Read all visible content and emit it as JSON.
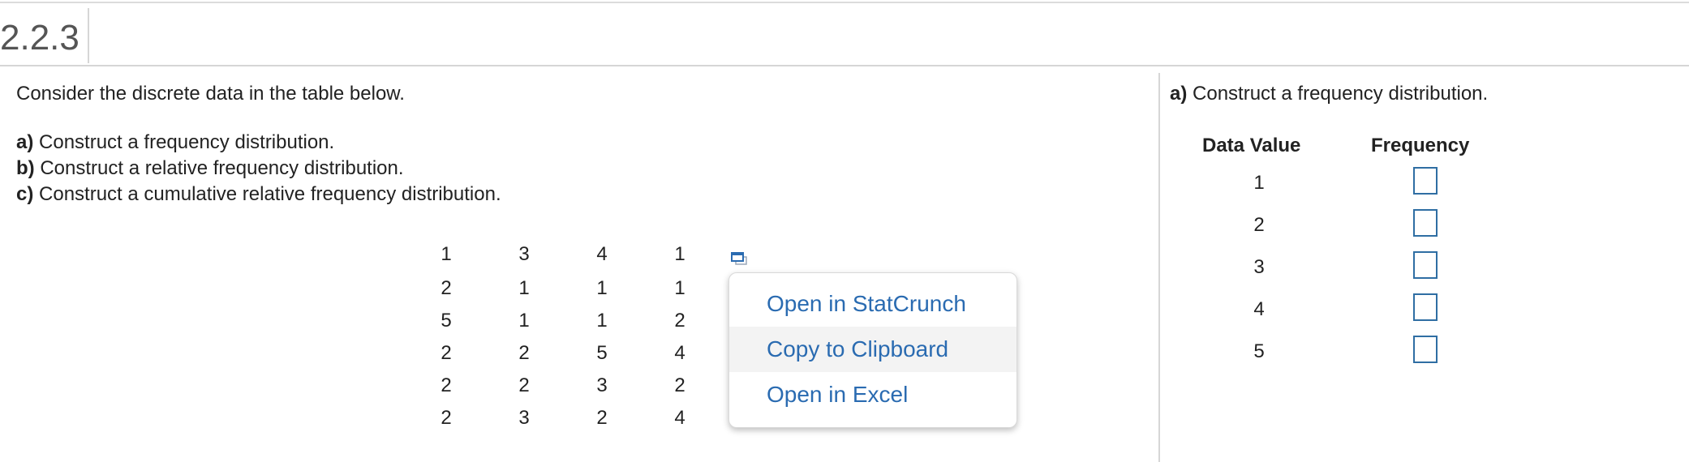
{
  "question_number": "2.2.3",
  "intro": "Consider the discrete data in the table below.",
  "tasks": [
    {
      "letter": "a)",
      "text": "Construct a frequency distribution."
    },
    {
      "letter": "b)",
      "text": "Construct a relative frequency distribution."
    },
    {
      "letter": "c)",
      "text": "Construct a cumulative relative frequency distribution."
    }
  ],
  "data_table": [
    [
      "1",
      "3",
      "4",
      "1"
    ],
    [
      "2",
      "1",
      "1",
      "1"
    ],
    [
      "5",
      "1",
      "1",
      "2"
    ],
    [
      "2",
      "2",
      "5",
      "4"
    ],
    [
      "2",
      "2",
      "3",
      "2"
    ],
    [
      "2",
      "3",
      "2",
      "4"
    ]
  ],
  "context_menu": [
    {
      "label": "Open in StatCrunch",
      "highlighted": false
    },
    {
      "label": "Copy to Clipboard",
      "highlighted": true
    },
    {
      "label": "Open in Excel",
      "highlighted": false
    }
  ],
  "answer": {
    "letter": "a)",
    "title": "Construct a frequency distribution.",
    "headers": {
      "data_value": "Data Value",
      "frequency": "Frequency"
    },
    "rows": [
      {
        "value": "1",
        "frequency": ""
      },
      {
        "value": "2",
        "frequency": ""
      },
      {
        "value": "3",
        "frequency": ""
      },
      {
        "value": "4",
        "frequency": ""
      },
      {
        "value": "5",
        "frequency": ""
      }
    ]
  },
  "colors": {
    "link": "#2a6bb1",
    "input_border": "#2f6ea3"
  },
  "icons": {
    "popout": "popout-window-icon"
  }
}
